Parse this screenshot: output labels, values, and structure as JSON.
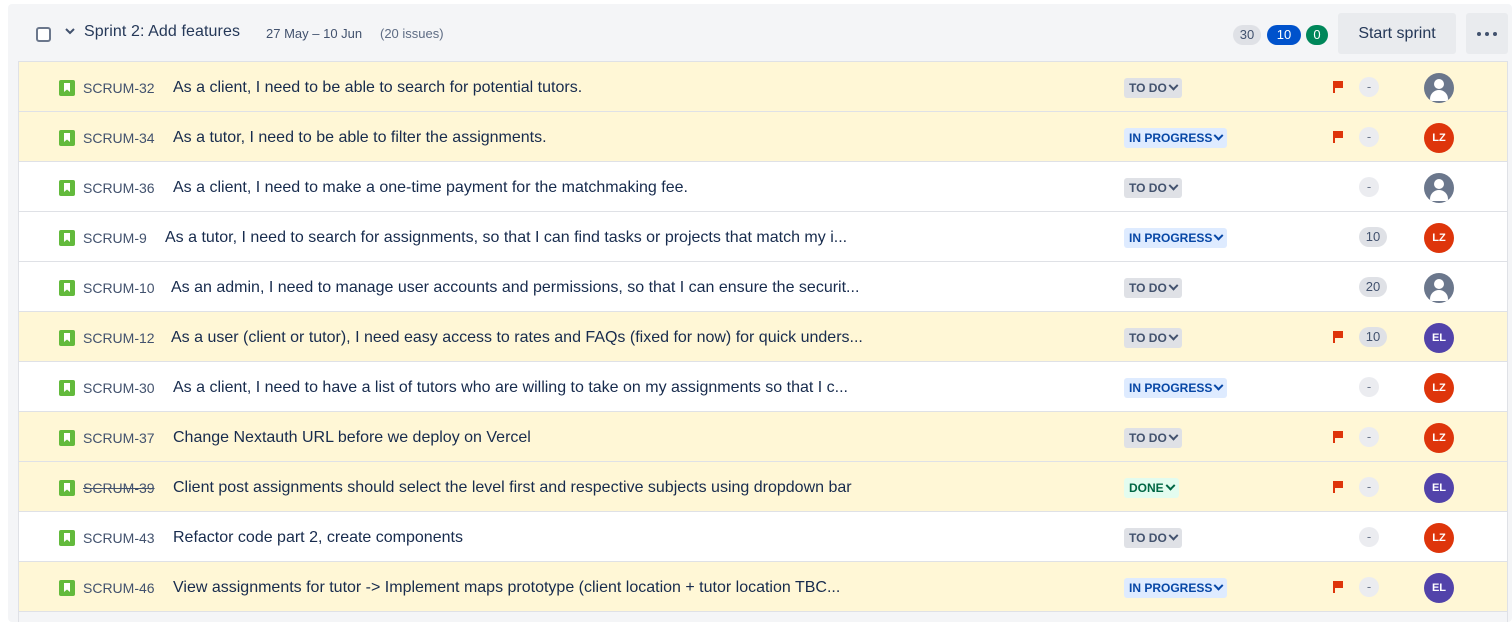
{
  "sprint": {
    "name": "Sprint 2: Add features",
    "dates": "27 May – 10 Jun",
    "issue_count": "(20 issues)",
    "counts": {
      "todo": "30",
      "in_progress": "10",
      "done": "0"
    },
    "start_button": "Start sprint"
  },
  "colors": {
    "flagged_row": "#fff7d6",
    "story_icon": "#63ba3c",
    "flag": "#de350b",
    "avatar_lz": "#de350b",
    "avatar_el": "#5243aa"
  },
  "issues": [
    {
      "key": "SCRUM-32",
      "summary": "As a client, I need to be able to search for potential tutors.",
      "status": "TO DO",
      "flagged": true,
      "estimate": "-",
      "assignee": "unassigned"
    },
    {
      "key": "SCRUM-34",
      "summary": "As a tutor, I need to be able to filter the assignments.",
      "status": "IN PROGRESS",
      "flagged": true,
      "estimate": "-",
      "assignee": "LZ"
    },
    {
      "key": "SCRUM-36",
      "summary": "As a client, I need to make a one-time payment for the matchmaking fee.",
      "status": "TO DO",
      "flagged": false,
      "estimate": "-",
      "assignee": "unassigned"
    },
    {
      "key": "SCRUM-9",
      "summary": "As a tutor, I need to search for assignments, so that I can find tasks or projects that match my i...",
      "status": "IN PROGRESS",
      "flagged": false,
      "estimate": "10",
      "assignee": "LZ"
    },
    {
      "key": "SCRUM-10",
      "summary": "As an admin, I need to manage user accounts and permissions, so that I can ensure the securit...",
      "status": "TO DO",
      "flagged": false,
      "estimate": "20",
      "assignee": "unassigned"
    },
    {
      "key": "SCRUM-12",
      "summary": "As a user (client or tutor), I need easy access to rates and FAQs (fixed for now) for quick unders...",
      "status": "TO DO",
      "flagged": true,
      "estimate": "10",
      "assignee": "EL"
    },
    {
      "key": "SCRUM-30",
      "summary": "As a client, I need to have a list of tutors who are willing to take on my assignments so that I c...",
      "status": "IN PROGRESS",
      "flagged": false,
      "estimate": "-",
      "assignee": "LZ"
    },
    {
      "key": "SCRUM-37",
      "summary": "Change Nextauth URL before we deploy on Vercel",
      "status": "TO DO",
      "flagged": true,
      "estimate": "-",
      "assignee": "LZ"
    },
    {
      "key": "SCRUM-39",
      "summary": "Client post assignments should select the level first and respective subjects using dropdown bar",
      "status": "DONE",
      "flagged": true,
      "estimate": "-",
      "assignee": "EL"
    },
    {
      "key": "SCRUM-43",
      "summary": "Refactor code part 2, create components",
      "status": "TO DO",
      "flagged": false,
      "estimate": "-",
      "assignee": "LZ"
    },
    {
      "key": "SCRUM-46",
      "summary": "View assignments for tutor -> Implement maps prototype (client location + tutor location TBC...",
      "status": "IN PROGRESS",
      "flagged": true,
      "estimate": "-",
      "assignee": "EL"
    }
  ]
}
